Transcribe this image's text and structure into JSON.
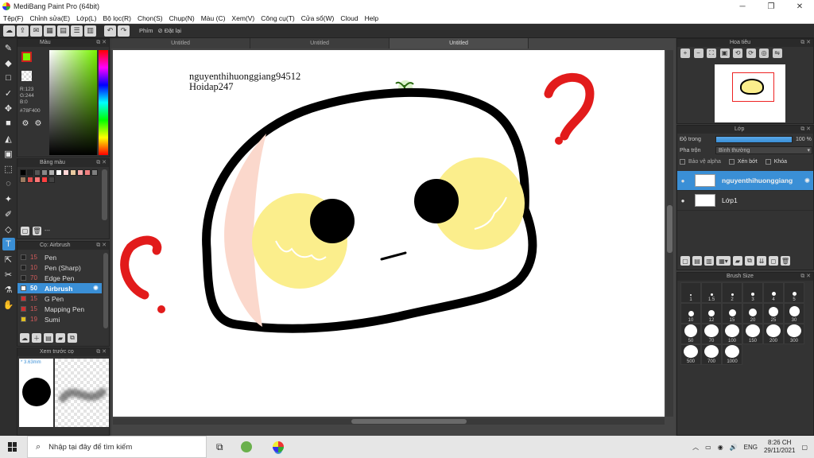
{
  "titlebar": {
    "title": "MediBang Paint Pro (64bit)",
    "minimize": "─",
    "maximize": "❐",
    "close": "✕"
  },
  "menu": [
    "Tệp(F)",
    "Chỉnh sửa(E)",
    "Lớp(L)",
    "Bộ lọc(R)",
    "Chọn(S)",
    "Chụp(N)",
    "Màu (C)",
    "Xem(V)",
    "Công cụ(T)",
    "Cửa sổ(W)",
    "Cloud",
    "Help"
  ],
  "toolbar": {
    "phim_label": "Phím",
    "reset_label": "Đặt lại"
  },
  "panels": {
    "color": {
      "title": "Màu",
      "r": "R:123",
      "g": "G:244",
      "b": "B:0",
      "hex": "#78F400",
      "current": "#7bf400"
    },
    "palette": {
      "title": "Bảng màu",
      "dash": "---",
      "swatches": [
        "#000000",
        "#222222",
        "#555555",
        "#888888",
        "#b0b0b0",
        "#ffffff",
        "#ffd6d6",
        "#e8c9a0",
        "#f7a8a8",
        "#f08080",
        "#7f7f7f",
        "#9a7a60",
        "#e05050",
        "#ff7777",
        "#ff4040",
        "#444444"
      ]
    },
    "brush": {
      "title": "Cọ: Airbrush",
      "items": [
        {
          "size": "15",
          "name": "Pen",
          "color": "#222222"
        },
        {
          "size": "10",
          "name": "Pen (Sharp)",
          "color": "#222222"
        },
        {
          "size": "70",
          "name": "Edge Pen",
          "color": "#222222"
        },
        {
          "size": "50",
          "name": "Airbrush",
          "color": "#ffffff",
          "active": true
        },
        {
          "size": "15",
          "name": "G Pen",
          "color": "#d03030"
        },
        {
          "size": "15",
          "name": "Mapping Pen",
          "color": "#d03030"
        },
        {
          "size": "19",
          "name": "Sumi",
          "color": "#e0c020"
        }
      ]
    },
    "preview": {
      "title": "Xem trước cọ",
      "size_text": "* 3.63mm"
    },
    "navigator": {
      "title": "Hoa tiêu"
    },
    "layer": {
      "title": "Lớp",
      "opacity_label": "Độ trong",
      "opacity_value": "100 %",
      "blend_label": "Pha trộn",
      "blend_value": "Bình thường",
      "protect_alpha": "Bảo vệ alpha",
      "clip": "Xén bớt",
      "lock": "Khóa",
      "layers": [
        {
          "name": "nguyenthihuonggiang",
          "active": true
        },
        {
          "name": "Lớp1",
          "active": false
        }
      ]
    },
    "brush_size": {
      "title": "Brush Size",
      "sizes": [
        "1",
        "1.5",
        "2",
        "3",
        "4",
        "5",
        "10",
        "12",
        "15",
        "20",
        "25",
        "30",
        "50",
        "70",
        "100",
        "150",
        "200",
        "300",
        "500",
        "700",
        "1000"
      ]
    }
  },
  "tabs": [
    "Untitled",
    "Untitled",
    "Untitled"
  ],
  "canvas": {
    "watermark1": "nguyenthihuonggiang94512",
    "watermark2": "Hoidap247"
  },
  "taskbar": {
    "search_placeholder": "Nhập tại đây để tìm kiếm",
    "lang": "ENG",
    "time": "8:26 CH",
    "date": "29/11/2021"
  }
}
